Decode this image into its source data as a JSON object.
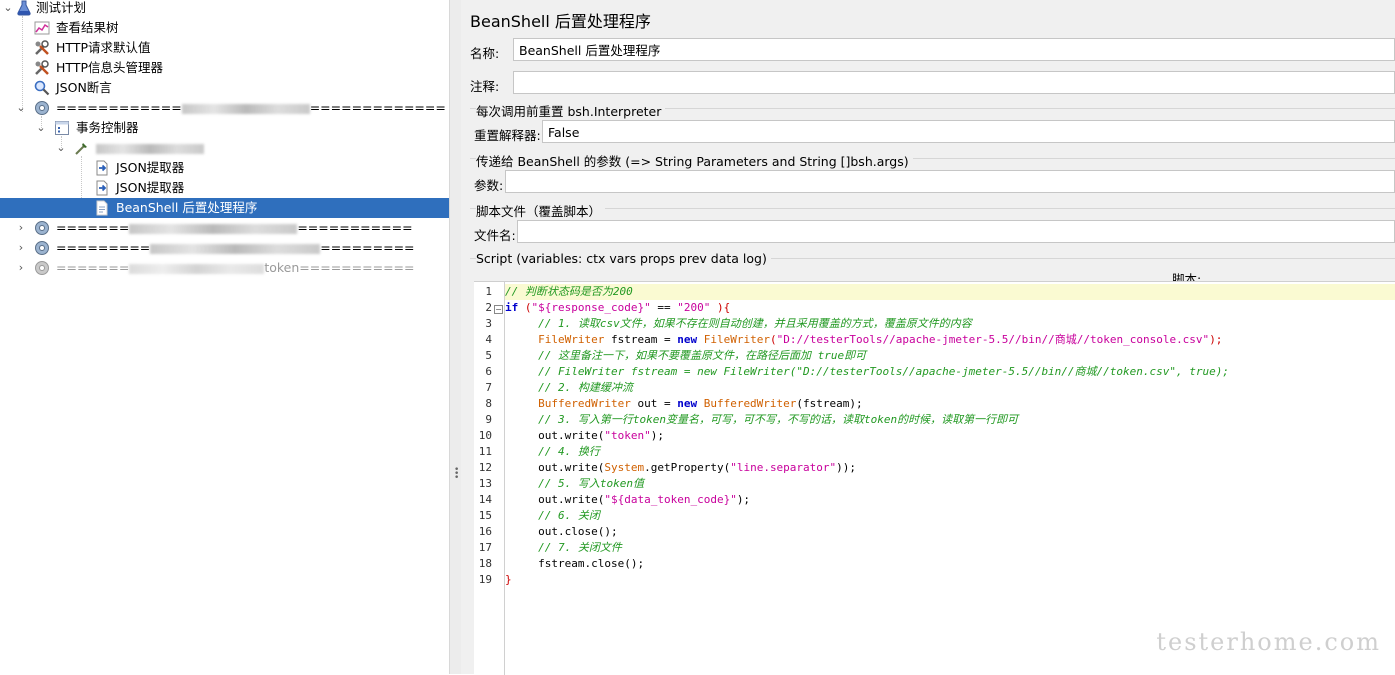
{
  "tree": {
    "plan": "测试计划",
    "view_results": "查看结果树",
    "http_defaults": "HTTP请求默认值",
    "http_header": "HTTP信息头管理器",
    "json_assert": "JSON断言",
    "thread_group_1": "============",
    "thread_group_1_tail": "=============",
    "transaction": "事务控制器",
    "json_extractor_1": "JSON提取器",
    "json_extractor_2": "JSON提取器",
    "beanshell": "BeanShell 后置处理程序",
    "thread_group_2": "=======",
    "thread_group_2_tail": "===========",
    "thread_group_3": "=========",
    "thread_group_3_tail": "=========",
    "thread_group_4": "=======",
    "thread_group_4_tail": "token===========",
    "colors": {
      "selected_bg": "#2f6fbd"
    }
  },
  "panel": {
    "title": "BeanShell 后置处理程序",
    "name_label": "名称:",
    "name_value": "BeanShell 后置处理程序",
    "comment_label": "注释:",
    "comment_value": "",
    "reset_section": "每次调用前重置 bsh.Interpreter",
    "reset_label": "重置解释器:",
    "reset_value": "False",
    "params_section": "传递给 BeanShell 的参数 (=> String Parameters and String []bsh.args)",
    "params_label": "参数:",
    "params_value": "",
    "file_section": "脚本文件（覆盖脚本）",
    "file_label": "文件名:",
    "file_value": "",
    "script_section": "Script (variables: ctx vars props prev data log)",
    "script_label": "脚本:"
  },
  "editor": {
    "line_numbers": [
      "1",
      "2",
      "3",
      "4",
      "5",
      "6",
      "7",
      "8",
      "9",
      "10",
      "11",
      "12",
      "13",
      "14",
      "15",
      "16",
      "17",
      "18",
      "19"
    ],
    "code": {
      "l1": "// 判断状态码是否为200",
      "l2a": "if",
      "l2b": " (",
      "l2c": "\"${response_code}\"",
      "l2d": " == ",
      "l2e": "\"200\"",
      "l2f": " ){",
      "l3": "// 1. 读取csv文件，如果不存在则自动创建，并且采用覆盖的方式，覆盖原文件的内容",
      "l4a": "FileWriter",
      "l4b": " fstream = ",
      "l4c": "new",
      "l4d": " ",
      "l4e": "FileWriter",
      "l4f": "(",
      "l4g": "\"D://testerTools//apache-jmeter-5.5//bin//商城//token_console.csv\"",
      "l4h": ");",
      "l5": "// 这里备注一下，如果不要覆盖原文件，在路径后面加 true即可",
      "l6": "// FileWriter fstream = new FileWriter(\"D://testerTools//apache-jmeter-5.5//bin//商城//token.csv\", true);",
      "l7": "// 2. 构建缓冲流",
      "l8a": "BufferedWriter",
      "l8b": " out = ",
      "l8c": "new",
      "l8d": " ",
      "l8e": "BufferedWriter",
      "l8f": "(fstream);",
      "l9": "// 3. 写入第一行token变量名，可写，可不写，不写的话，读取token的时候，读取第一行即可",
      "l10a": "out.write(",
      "l10b": "\"token\"",
      "l10c": ");",
      "l11": "// 4. 换行",
      "l12a": "out.write(",
      "l12b": "System",
      "l12c": ".getProperty(",
      "l12d": "\"line.separator\"",
      "l12e": "));",
      "l13": "// 5. 写入token值",
      "l14a": "out.write(",
      "l14b": "\"${data_token_code}\"",
      "l14c": ");",
      "l15": "// 6. 关闭",
      "l16": "out.close();",
      "l17": "// 7. 关闭文件",
      "l18": "fstream.close();",
      "l19": "}"
    }
  },
  "watermark": "testerhome.com"
}
